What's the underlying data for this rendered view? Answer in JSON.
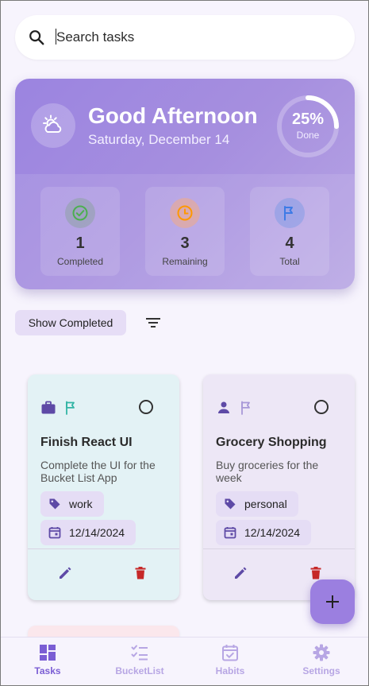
{
  "search": {
    "placeholder": "Search tasks",
    "icon": "search-icon"
  },
  "header": {
    "greeting": "Good Afternoon",
    "date": "Saturday, December 14",
    "weather_icon": "partly-cloudy-icon",
    "progress": {
      "percent_label": "25%",
      "label": "Done",
      "fraction": 0.25
    },
    "stats": [
      {
        "value": "1",
        "label": "Completed",
        "icon": "check-circle-icon",
        "color": "#4caf50"
      },
      {
        "value": "3",
        "label": "Remaining",
        "icon": "clock-icon",
        "color": "#ff9800"
      },
      {
        "value": "4",
        "label": "Total",
        "icon": "flag-icon",
        "color": "#3d7be6"
      }
    ]
  },
  "controls": {
    "show_completed_label": "Show Completed",
    "filter_icon": "filter-icon"
  },
  "tasks": [
    {
      "title": "Finish React UI",
      "description": "Complete the UI for the Bucket List App",
      "category": "work",
      "date": "12/14/2024",
      "category_icon": "briefcase-icon",
      "priority_icon": "flag-outline-icon",
      "priority_color": "#33b5a5",
      "background": "#e3f2f5"
    },
    {
      "title": "Grocery Shopping",
      "description": "Buy groceries for the week",
      "category": "personal",
      "date": "12/14/2024",
      "category_icon": "person-icon",
      "priority_icon": "flag-outline-icon",
      "priority_color": "#a898d8",
      "background": "#ede7f6"
    }
  ],
  "nav": {
    "items": [
      {
        "label": "Tasks",
        "icon": "dashboard-icon",
        "active": true
      },
      {
        "label": "BucketList",
        "icon": "checklist-icon",
        "active": false
      },
      {
        "label": "Habits",
        "icon": "calendar-check-icon",
        "active": false
      },
      {
        "label": "Settings",
        "icon": "gear-icon",
        "active": false
      }
    ]
  },
  "colors": {
    "accent": "#9b7fe0",
    "nav_active": "#7b5ed4",
    "nav_inactive": "#b7a6e4",
    "delete": "#c62828",
    "edit": "#5e4aa6"
  }
}
